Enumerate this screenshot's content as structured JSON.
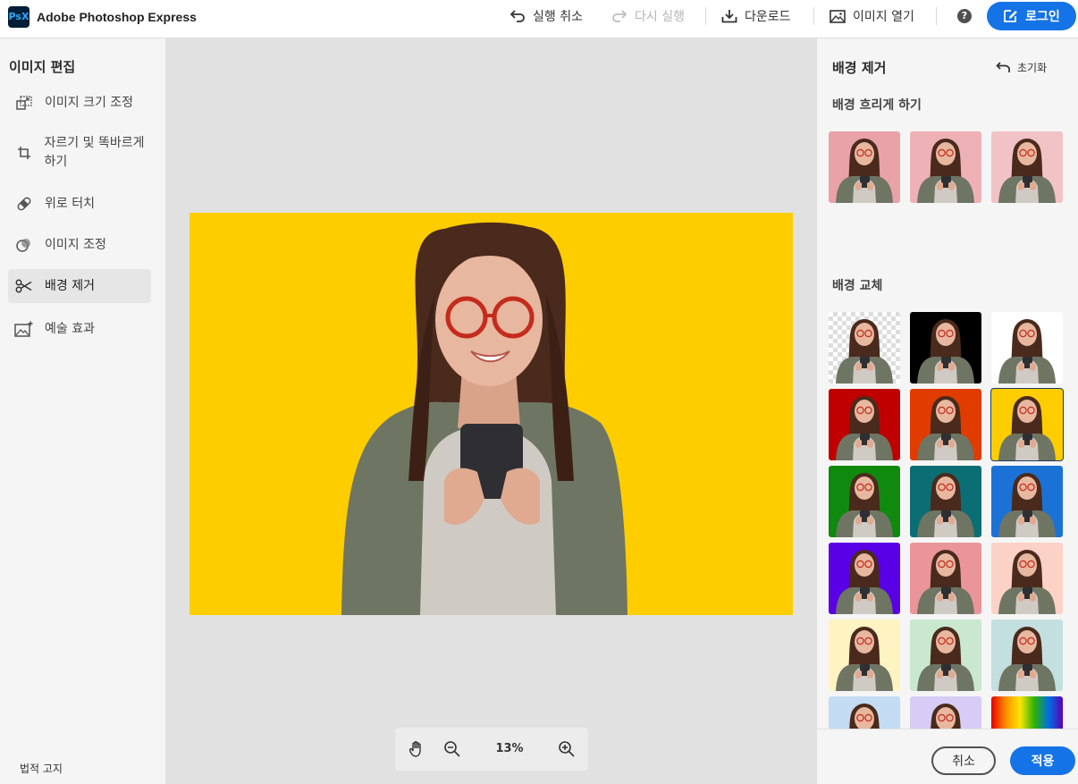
{
  "app": {
    "logo_text": "PsX",
    "title": "Adobe Photoshop Express"
  },
  "toolbar": {
    "undo": "실행 취소",
    "redo": "다시 실행",
    "download": "다운로드",
    "open_image": "이미지 열기",
    "help": "?",
    "login": "로그인",
    "accent_color": "#1473e6"
  },
  "sidebar": {
    "title": "이미지 편집",
    "items": [
      {
        "label": "이미지 크기 조정",
        "icon": "resize-icon"
      },
      {
        "label": "자르기 및 똑바르게 하기",
        "icon": "crop-icon"
      },
      {
        "label": "위로 터치",
        "icon": "bandage-icon"
      },
      {
        "label": "이미지 조정",
        "icon": "adjust-icon"
      },
      {
        "label": "배경 제거",
        "icon": "scissors-icon",
        "active": true
      },
      {
        "label": "예술 효과",
        "icon": "sparkle-image-icon"
      }
    ],
    "legal": "법적 고지"
  },
  "canvas": {
    "background_color": "#fecd00",
    "zoom": "13%"
  },
  "panel": {
    "title": "배경 제거",
    "reset": "초기화",
    "blur_section": "배경 흐리게 하기",
    "replace_section": "배경 교체",
    "blur_thumbs": [
      "#e8a2a8",
      "#eeb1b6",
      "#f2c3c6"
    ],
    "replace_thumbs": [
      {
        "color": "transparent",
        "type": "checker"
      },
      {
        "color": "#000000"
      },
      {
        "color": "#ffffff"
      },
      {
        "color": "#c00000"
      },
      {
        "color": "#e03c00"
      },
      {
        "color": "#fecd00",
        "selected": true
      },
      {
        "color": "#0f8a0f"
      },
      {
        "color": "#0c6e75"
      },
      {
        "color": "#1b72d6"
      },
      {
        "color": "#5a00e6"
      },
      {
        "color": "#ea959a"
      },
      {
        "color": "#fcd1c6"
      },
      {
        "color": "#fff3c2"
      },
      {
        "color": "#c9e8cf"
      },
      {
        "color": "#c4dfe0"
      },
      {
        "color": "#c4dcf3"
      },
      {
        "color": "#d6ccf6"
      },
      {
        "color": "rainbow",
        "type": "gradient"
      }
    ],
    "cancel": "취소",
    "apply": "적용"
  }
}
